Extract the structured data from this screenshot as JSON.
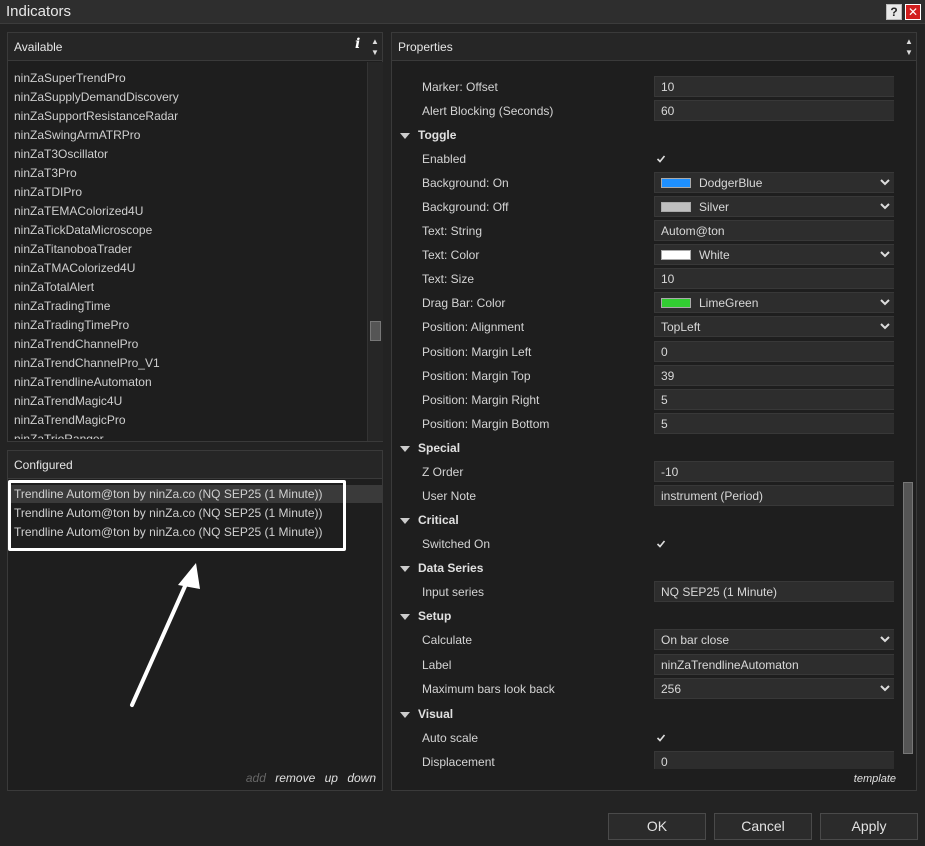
{
  "window": {
    "title": "Indicators",
    "help_label": "?",
    "close_label": "✕"
  },
  "available": {
    "header": "Available",
    "info_label": "i",
    "items": [
      "ninZaSuperTrendPro",
      "ninZaSupplyDemandDiscovery",
      "ninZaSupportResistanceRadar",
      "ninZaSwingArmATRPro",
      "ninZaT3Oscillator",
      "ninZaT3Pro",
      "ninZaTDIPro",
      "ninZaTEMAColorized4U",
      "ninZaTickDataMicroscope",
      "ninZaTitanoboaTrader",
      "ninZaTMAColorized4U",
      "ninZaTotalAlert",
      "ninZaTradingTime",
      "ninZaTradingTimePro",
      "ninZaTrendChannelPro",
      "ninZaTrendChannelPro_V1",
      "ninZaTrendlineAutomaton",
      "ninZaTrendMagic4U",
      "ninZaTrendMagicPro",
      "ninZaTrioRanger"
    ]
  },
  "configured": {
    "header": "Configured",
    "items": [
      "Trendline Autom@ton by ninZa.co (NQ SEP25 (1 Minute))",
      "Trendline Autom@ton by ninZa.co (NQ SEP25 (1 Minute))",
      "Trendline Autom@ton by ninZa.co (NQ SEP25 (1 Minute))"
    ],
    "actions": {
      "add": "add",
      "remove": "remove",
      "up": "up",
      "down": "down"
    }
  },
  "properties": {
    "header": "Properties",
    "template_label": "template",
    "rows": [
      {
        "type": "prop",
        "label": "Marker: Offset",
        "value": "10"
      },
      {
        "type": "prop",
        "label": "Alert Blocking (Seconds)",
        "value": "60"
      },
      {
        "type": "category",
        "label": "Toggle"
      },
      {
        "type": "check",
        "label": "Enabled",
        "checked": true
      },
      {
        "type": "color",
        "label": "Background: On",
        "value": "DodgerBlue",
        "color": "#1e90ff"
      },
      {
        "type": "color",
        "label": "Background: Off",
        "value": "Silver",
        "color": "#c0c0c0"
      },
      {
        "type": "prop",
        "label": "Text: String",
        "value": "Autom@ton"
      },
      {
        "type": "color",
        "label": "Text: Color",
        "value": "White",
        "color": "#ffffff"
      },
      {
        "type": "prop",
        "label": "Text: Size",
        "value": "10"
      },
      {
        "type": "color",
        "label": "Drag Bar: Color",
        "value": "LimeGreen",
        "color": "#32cd32"
      },
      {
        "type": "select",
        "label": "Position: Alignment",
        "value": "TopLeft"
      },
      {
        "type": "prop",
        "label": "Position: Margin Left",
        "value": "0"
      },
      {
        "type": "prop",
        "label": "Position: Margin Top",
        "value": "39"
      },
      {
        "type": "prop",
        "label": "Position: Margin Right",
        "value": "5"
      },
      {
        "type": "prop",
        "label": "Position: Margin Bottom",
        "value": "5"
      },
      {
        "type": "category",
        "label": "Special"
      },
      {
        "type": "prop",
        "label": "Z Order",
        "value": "-10"
      },
      {
        "type": "prop",
        "label": "User Note",
        "value": "instrument (Period)"
      },
      {
        "type": "category",
        "label": "Critical"
      },
      {
        "type": "check",
        "label": "Switched On",
        "checked": true
      },
      {
        "type": "category",
        "label": "Data Series"
      },
      {
        "type": "prop",
        "label": "Input series",
        "value": "NQ SEP25 (1 Minute)"
      },
      {
        "type": "category",
        "label": "Setup"
      },
      {
        "type": "select",
        "label": "Calculate",
        "value": "On bar close"
      },
      {
        "type": "prop",
        "label": "Label",
        "value": "ninZaTrendlineAutomaton"
      },
      {
        "type": "select",
        "label": "Maximum bars look back",
        "value": "256"
      },
      {
        "type": "category",
        "label": "Visual"
      },
      {
        "type": "check",
        "label": "Auto scale",
        "checked": true
      },
      {
        "type": "prop",
        "label": "Displacement",
        "value": "0"
      }
    ]
  },
  "buttons": {
    "ok": "OK",
    "cancel": "Cancel",
    "apply": "Apply"
  }
}
